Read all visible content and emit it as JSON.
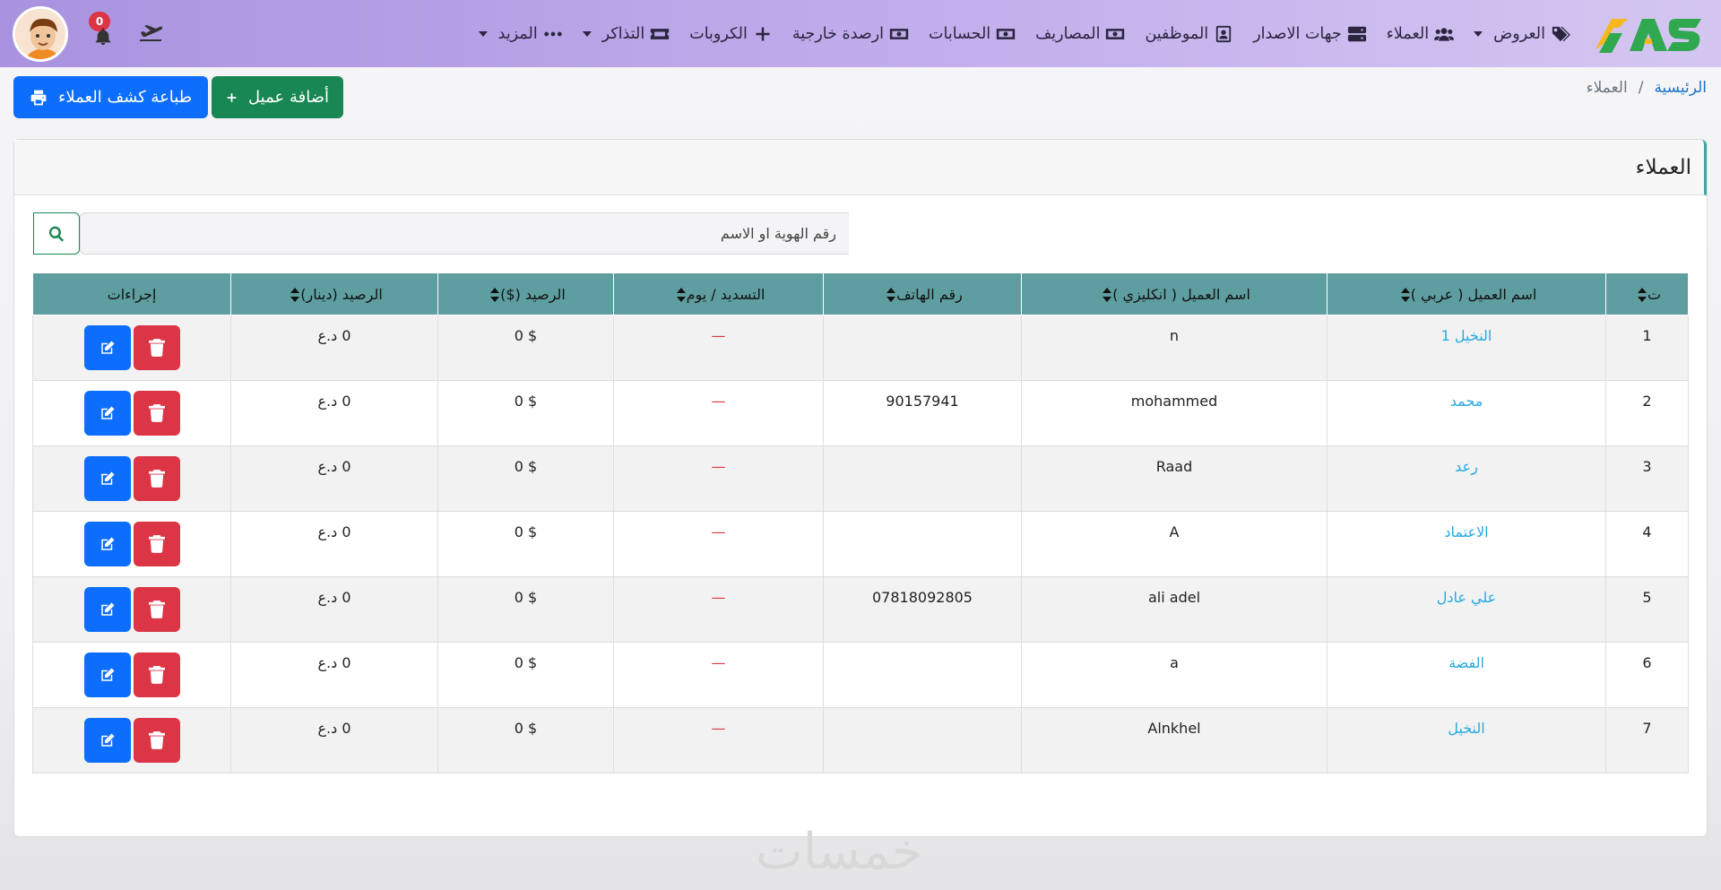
{
  "nav": {
    "items": [
      {
        "label": "العروض",
        "icon": "tags-icon",
        "dropdown": true
      },
      {
        "label": "العملاء",
        "icon": "users-icon",
        "dropdown": false
      },
      {
        "label": "جهات الاصدار",
        "icon": "server-icon",
        "dropdown": false
      },
      {
        "label": "الموظفين",
        "icon": "id-card-icon",
        "dropdown": false
      },
      {
        "label": "المصاريف",
        "icon": "money-icon",
        "dropdown": false
      },
      {
        "label": "الحسابات",
        "icon": "money-icon",
        "dropdown": false
      },
      {
        "label": "ارصدة خارجية",
        "icon": "money-icon",
        "dropdown": false
      },
      {
        "label": "الكروبات",
        "icon": "plus-icon",
        "dropdown": false
      },
      {
        "label": "التذاكر",
        "icon": "ticket-icon",
        "dropdown": true
      },
      {
        "label": "المزيد",
        "icon": "ellipsis-icon",
        "dropdown": true
      }
    ],
    "notifications_count": "0"
  },
  "breadcrumb": {
    "home": "الرئيسية",
    "separator": "/",
    "current": "العملاء"
  },
  "actions": {
    "add_label": "أضافة عميل",
    "print_label": "طباعة كشف العملاء"
  },
  "card": {
    "title": "العملاء"
  },
  "search": {
    "placeholder": "رقم الهوية او الاسم"
  },
  "table": {
    "headers": [
      "ت",
      "اسم العميل ( عربي )",
      "اسم العميل ( انكليزي )",
      "رقم الهاتف",
      "التسديد / يوم",
      "الرصيد ($)",
      "الرصيد (دينار)",
      "إجراءات"
    ],
    "rows": [
      {
        "n": "1",
        "name_ar": "النخيل 1",
        "name_en": "n",
        "phone": "",
        "pay": "—",
        "usd": "$ 0",
        "iqd": "0 د.ع"
      },
      {
        "n": "2",
        "name_ar": "محمد",
        "name_en": "mohammed",
        "phone": "90157941",
        "pay": "—",
        "usd": "$ 0",
        "iqd": "0 د.ع"
      },
      {
        "n": "3",
        "name_ar": "رعد",
        "name_en": "Raad",
        "phone": "",
        "pay": "—",
        "usd": "$ 0",
        "iqd": "0 د.ع"
      },
      {
        "n": "4",
        "name_ar": "الاعتماد",
        "name_en": "A",
        "phone": "",
        "pay": "—",
        "usd": "$ 0",
        "iqd": "0 د.ع"
      },
      {
        "n": "5",
        "name_ar": "علي عادل",
        "name_en": "ali adel",
        "phone": "07818092805",
        "pay": "—",
        "usd": "$ 0",
        "iqd": "0 د.ع"
      },
      {
        "n": "6",
        "name_ar": "الفضة",
        "name_en": "a",
        "phone": "",
        "pay": "—",
        "usd": "$ 0",
        "iqd": "0 د.ع"
      },
      {
        "n": "7",
        "name_ar": "النخيل",
        "name_en": "Alnkhel",
        "phone": "",
        "pay": "—",
        "usd": "$ 0",
        "iqd": "0 د.ع"
      }
    ]
  },
  "watermark": "خمسات",
  "colors": {
    "navbar": "#b7a3e8",
    "header_row": "#5f9ea0",
    "add": "#198754",
    "print": "#0d6efd",
    "delete": "#dc3545",
    "link": "#27a9e1"
  }
}
